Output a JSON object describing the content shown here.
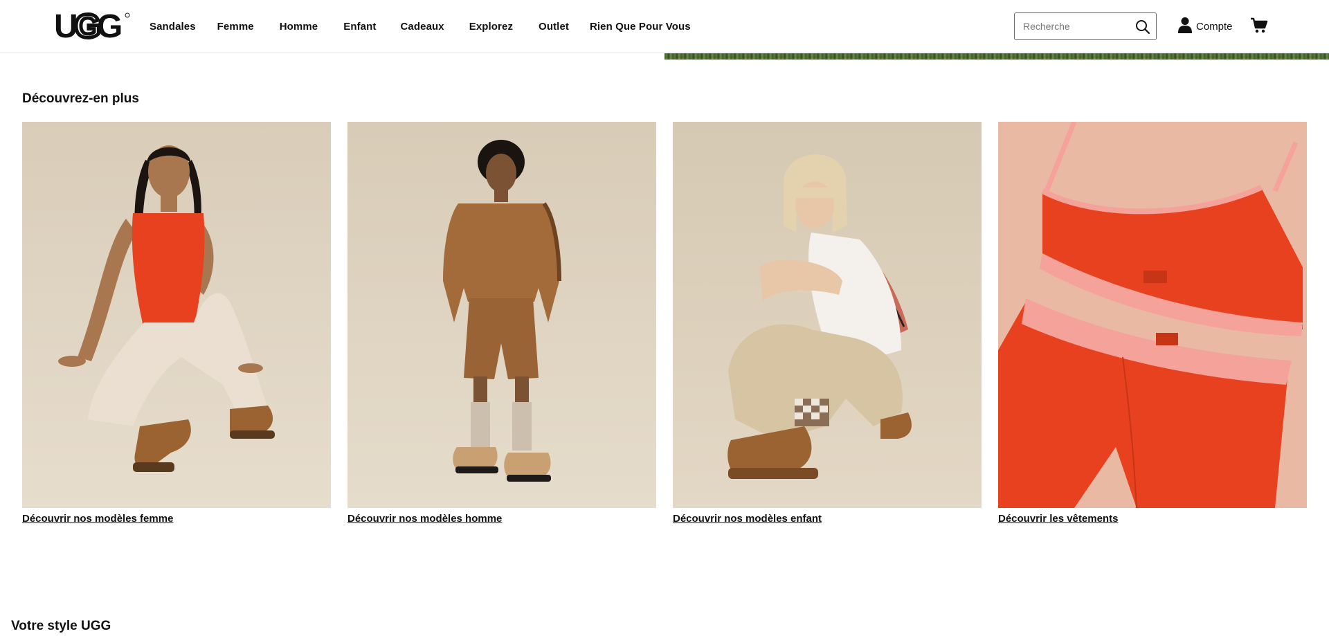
{
  "brand": {
    "name": "UGG"
  },
  "nav": {
    "items": [
      {
        "label": "Sandales"
      },
      {
        "label": "Femme"
      },
      {
        "label": "Homme"
      },
      {
        "label": "Enfant"
      },
      {
        "label": "Cadeaux"
      },
      {
        "label": "Explorez"
      },
      {
        "label": "Outlet"
      },
      {
        "label": "Rien Que Pour Vous"
      }
    ]
  },
  "search": {
    "placeholder": "Recherche",
    "value": ""
  },
  "account": {
    "label": "Compte"
  },
  "discover": {
    "title": "Découvrez-en plus",
    "cards": [
      {
        "link": "Découvrir nos modèles femme"
      },
      {
        "link": "Découvrir nos modèles homme"
      },
      {
        "link": "Découvrir nos modèles enfant"
      },
      {
        "link": "Découvrir les vêtements"
      }
    ]
  },
  "style_section": {
    "title": "Votre style UGG"
  },
  "colors": {
    "text": "#111111",
    "background": "#ffffff",
    "backdrop_beige": "#d8ccb8",
    "accent_red": "#e8411f",
    "pink_trim": "#f2a39a"
  },
  "icons": [
    "search-icon",
    "user-icon",
    "cart-icon"
  ]
}
